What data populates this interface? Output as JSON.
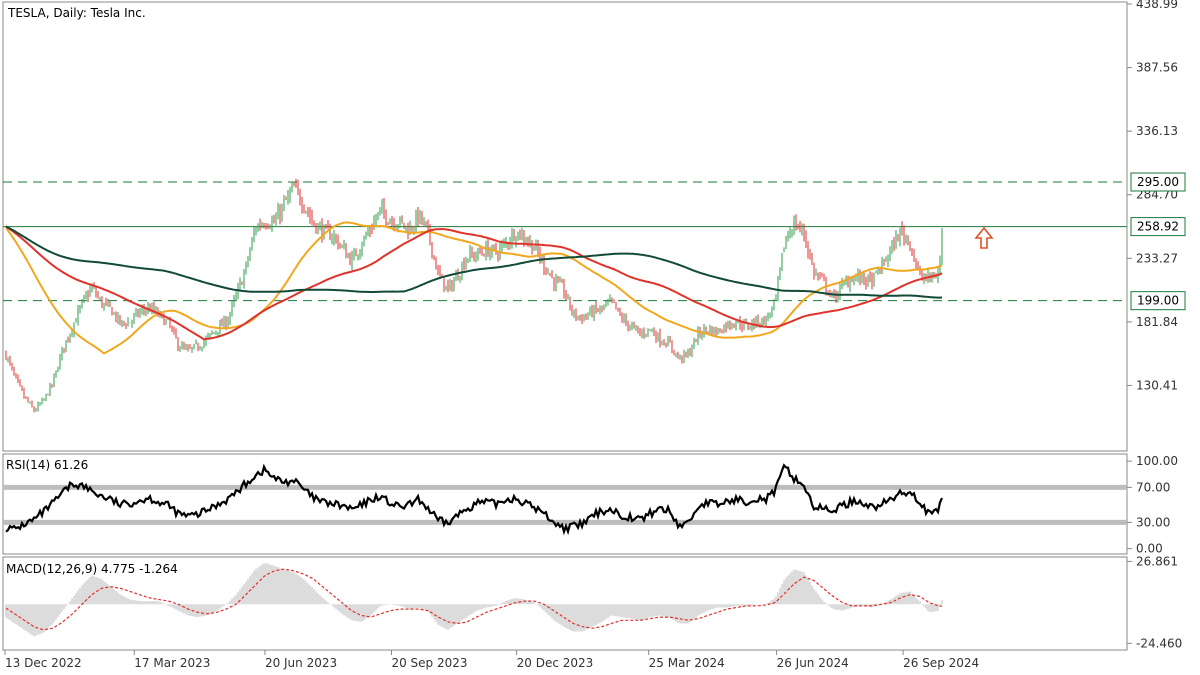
{
  "chart_data": [
    {
      "type": "candlestick",
      "title": "TESLA, Daily:  Tesla Inc.",
      "y_ticks": [
        "438.99",
        "387.56",
        "336.13",
        "284.70",
        "233.27",
        "181.84",
        "130.41"
      ],
      "ylim": [
        79.0,
        439.0
      ],
      "x_ticks": [
        "13 Dec 2022",
        "17 Mar 2023",
        "20 Jun 2023",
        "20 Sep 2023",
        "20 Dec 2023",
        "25 Mar 2024",
        "26 Jun 2024",
        "26 Sep 2024"
      ],
      "xlim": [
        "2022-12-13",
        "2024-10-25"
      ],
      "levels": [
        {
          "price": 295.0,
          "label": "295.00",
          "style": "dashed",
          "color": "#1a7a3a"
        },
        {
          "price": 258.92,
          "label": "258.92",
          "style": "solid",
          "color": "#1a7a3a"
        },
        {
          "price": 199.0,
          "label": "199.00",
          "style": "dashed",
          "color": "#1a7a3a"
        }
      ],
      "candle_colors": {
        "up": "#2e9b48",
        "down": "#d9302f"
      },
      "annotation": {
        "type": "arrow-up",
        "color": "#e0502a"
      },
      "close_series": {
        "name": "",
        "x": [
          "2022-12-13",
          "2022-12-20",
          "2022-12-27",
          "2023-01-03",
          "2023-01-10",
          "2023-01-17",
          "2023-01-24",
          "2023-01-31",
          "2023-02-07",
          "2023-02-14",
          "2023-02-21",
          "2023-02-28",
          "2023-03-07",
          "2023-03-14",
          "2023-03-21",
          "2023-03-28",
          "2023-04-04",
          "2023-04-11",
          "2023-04-18",
          "2023-04-25",
          "2023-05-02",
          "2023-05-09",
          "2023-05-16",
          "2023-05-23",
          "2023-05-30",
          "2023-06-06",
          "2023-06-13",
          "2023-06-20",
          "2023-06-27",
          "2023-07-04",
          "2023-07-11",
          "2023-07-18",
          "2023-07-25",
          "2023-08-01",
          "2023-08-08",
          "2023-08-15",
          "2023-08-22",
          "2023-08-29",
          "2023-09-05",
          "2023-09-12",
          "2023-09-19",
          "2023-09-26",
          "2023-10-03",
          "2023-10-10",
          "2023-10-17",
          "2023-10-24",
          "2023-10-31",
          "2023-11-07",
          "2023-11-14",
          "2023-11-21",
          "2023-11-28",
          "2023-12-05",
          "2023-12-12",
          "2023-12-19",
          "2023-12-26",
          "2024-01-02",
          "2024-01-09",
          "2024-01-16",
          "2024-01-23",
          "2024-01-30",
          "2024-02-06",
          "2024-02-13",
          "2024-02-20",
          "2024-02-27",
          "2024-03-05",
          "2024-03-12",
          "2024-03-19",
          "2024-03-26",
          "2024-04-02",
          "2024-04-09",
          "2024-04-16",
          "2024-04-23",
          "2024-04-30",
          "2024-05-07",
          "2024-05-14",
          "2024-05-21",
          "2024-05-28",
          "2024-06-04",
          "2024-06-11",
          "2024-06-18",
          "2024-06-25",
          "2024-07-02",
          "2024-07-09",
          "2024-07-16",
          "2024-07-23",
          "2024-07-30",
          "2024-08-06",
          "2024-08-13",
          "2024-08-20",
          "2024-08-27",
          "2024-09-03",
          "2024-09-10",
          "2024-09-17",
          "2024-09-24",
          "2024-10-01",
          "2024-10-08",
          "2024-10-15",
          "2024-10-22",
          "2024-10-25"
        ],
        "values": [
          157,
          137,
          121,
          110,
          118,
          133,
          160,
          178,
          196,
          210,
          197,
          192,
          180,
          182,
          190,
          193,
          187,
          180,
          163,
          158,
          162,
          168,
          176,
          182,
          202,
          225,
          258,
          264,
          262,
          277,
          290,
          278,
          262,
          255,
          252,
          242,
          231,
          245,
          258,
          272,
          265,
          262,
          256,
          268,
          252,
          220,
          207,
          220,
          235,
          236,
          240,
          238,
          245,
          255,
          250,
          242,
          228,
          215,
          208,
          188,
          185,
          190,
          192,
          198,
          185,
          178,
          172,
          176,
          168,
          164,
          152,
          156,
          172,
          176,
          174,
          180,
          182,
          178,
          182,
          183,
          197,
          248,
          262,
          253,
          222,
          214,
          200,
          211,
          218,
          217,
          214,
          226,
          240,
          255,
          246,
          218,
          217,
          221,
          262
        ]
      }
    },
    {
      "type": "line",
      "title": "RSI(14) 61.26",
      "y_ticks": [
        "100.00",
        "70.00",
        "30.00",
        "0.00"
      ],
      "ylim": [
        -5,
        107
      ],
      "levels": [
        70,
        30
      ],
      "series": [
        {
          "name": "",
          "values": [
            24,
            22,
            28,
            33,
            42,
            52,
            64,
            74,
            72,
            66,
            60,
            56,
            50,
            52,
            55,
            58,
            53,
            49,
            40,
            37,
            39,
            44,
            50,
            56,
            64,
            74,
            84,
            90,
            80,
            76,
            78,
            68,
            58,
            53,
            51,
            49,
            45,
            49,
            56,
            60,
            52,
            47,
            50,
            56,
            45,
            32,
            29,
            38,
            46,
            52,
            53,
            51,
            56,
            58,
            52,
            47,
            40,
            31,
            23,
            25,
            28,
            37,
            43,
            45,
            38,
            36,
            33,
            40,
            46,
            43,
            26,
            30,
            48,
            53,
            50,
            54,
            56,
            54,
            58,
            56,
            66,
            94,
            80,
            72,
            48,
            45,
            44,
            49,
            54,
            54,
            47,
            50,
            56,
            63,
            66,
            54,
            38,
            44,
            61.26
          ]
        }
      ]
    },
    {
      "type": "bar+line",
      "title": "MACD(12,26,9) 4.775 -1.264",
      "y_ticks": [
        "26.861",
        "-24.460"
      ],
      "ylim": [
        -28,
        29
      ],
      "series": [
        {
          "name": "",
          "kind": "histogram",
          "values": [
            -8,
            -12,
            -16,
            -20,
            -18,
            -12,
            -4,
            4,
            12,
            18,
            16,
            11,
            6,
            3,
            2,
            2,
            2,
            -1,
            -4,
            -7,
            -8,
            -7,
            -4,
            0,
            6,
            14,
            22,
            26,
            24,
            22,
            20,
            16,
            10,
            4,
            -1,
            -6,
            -10,
            -11,
            -7,
            -1,
            0,
            -1,
            -3,
            -2,
            -5,
            -13,
            -16,
            -12,
            -8,
            -4,
            -2,
            -1,
            2,
            4,
            3,
            1,
            -4,
            -10,
            -14,
            -17,
            -17,
            -14,
            -11,
            -7,
            -8,
            -9,
            -10,
            -8,
            -7,
            -8,
            -12,
            -12,
            -7,
            -4,
            -2,
            -2,
            -1,
            -1,
            0,
            0,
            4,
            16,
            22,
            20,
            10,
            2,
            -3,
            -4,
            -2,
            -1,
            -2,
            0,
            3,
            7,
            8,
            2,
            -5,
            -4,
            4.775
          ]
        },
        {
          "name": "",
          "kind": "signal",
          "values": [
            -2,
            -6,
            -10,
            -14,
            -16,
            -15,
            -11,
            -6,
            0,
            6,
            10,
            11,
            10,
            8,
            6,
            4,
            3,
            2,
            0,
            -3,
            -5,
            -6,
            -5,
            -3,
            0,
            6,
            12,
            18,
            21,
            22,
            21,
            19,
            16,
            11,
            6,
            1,
            -4,
            -7,
            -8,
            -6,
            -4,
            -3,
            -3,
            -3,
            -4,
            -8,
            -11,
            -12,
            -11,
            -8,
            -5,
            -3,
            -1,
            1,
            2,
            2,
            0,
            -4,
            -8,
            -12,
            -14,
            -15,
            -14,
            -12,
            -10,
            -10,
            -10,
            -9,
            -8,
            -8,
            -9,
            -10,
            -9,
            -7,
            -5,
            -3,
            -2,
            -1,
            -1,
            -0.5,
            1,
            7,
            13,
            17,
            15,
            10,
            5,
            1,
            -1,
            -1,
            -1,
            0,
            1,
            4,
            6,
            5,
            1,
            -1,
            -1.264
          ]
        }
      ]
    }
  ]
}
